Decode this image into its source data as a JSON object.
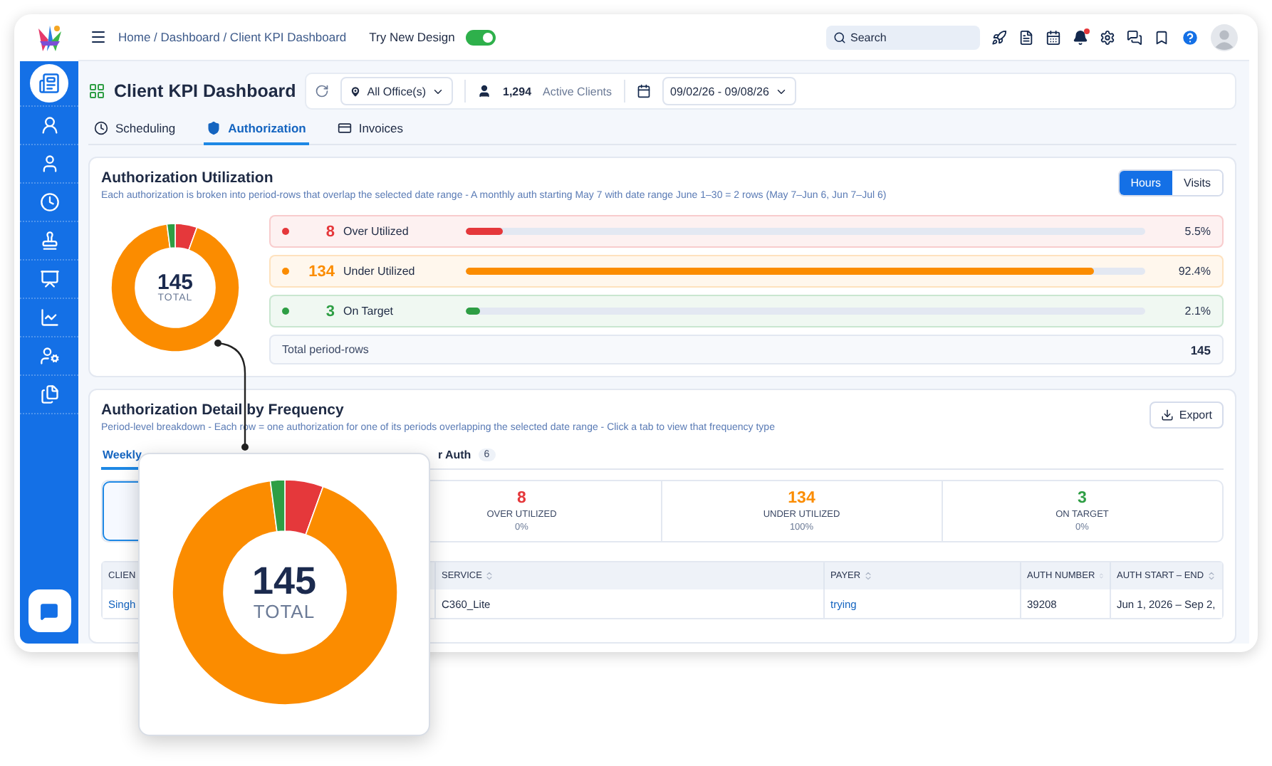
{
  "topbar": {
    "breadcrumb": "Home / Dashboard / Client KPI Dashboard",
    "new_design": {
      "label": "Try New Design",
      "on": true
    },
    "search": {
      "placeholder": "Search"
    },
    "notifications_unread": true
  },
  "sidebar": {
    "items": [
      {
        "selected": true
      },
      {
        "selected": false
      },
      {
        "selected": false
      },
      {
        "selected": false
      },
      {
        "selected": false
      },
      {
        "selected": false
      },
      {
        "selected": false
      },
      {
        "selected": false
      },
      {
        "selected": false
      }
    ]
  },
  "header": {
    "title": "Client KPI Dashboard",
    "office": "All Office(s)",
    "clients_count": "1,294",
    "clients_label": "Active Clients",
    "date_range": "09/02/26 - 09/08/26"
  },
  "tabs": [
    {
      "label": "Scheduling",
      "selected": false
    },
    {
      "label": "Authorization",
      "selected": true
    },
    {
      "label": "Invoices",
      "selected": false
    }
  ],
  "utilization": {
    "title": "Authorization Utilization",
    "subtitle": "Each authorization is broken into period-rows that overlap the selected date range - A monthly auth starting May 7 with date range June 1–30 = 2 rows (May 7–Jun 6, Jun 7–Jul 6)",
    "units": [
      {
        "label": "Hours",
        "selected": true
      },
      {
        "label": "Visits",
        "selected": false
      }
    ],
    "total": "145",
    "total_label": "TOTAL",
    "rows": [
      {
        "count": "8",
        "label": "Over Utilized",
        "level": 0.055,
        "percent": "5.5%",
        "color": "#e5383b"
      },
      {
        "count": "134",
        "label": "Under Utilized",
        "level": 0.924,
        "percent": "92.4%",
        "color": "#fb8c00"
      },
      {
        "count": "3",
        "label": "On Target",
        "level": 0.021,
        "percent": "2.1%",
        "color": "#2e9e44"
      }
    ],
    "total_row": {
      "label": "Total period-rows",
      "value": "145"
    }
  },
  "detail": {
    "title": "Authorization Detail by Frequency",
    "subtitle": "Period-level breakdown - Each row = one authorization for one of its periods overlapping the selected date range - Click a tab to view that frequency type",
    "export": "Export",
    "tabs": [
      {
        "label": "Weekly",
        "selected": true
      },
      {
        "label": "r Auth",
        "count": "6",
        "selected": false
      }
    ],
    "stats": [
      {
        "selected": true
      },
      {
        "value": "8",
        "label": "OVER UTILIZED",
        "percent": "0%",
        "color": "#e5383b",
        "selected": false
      },
      {
        "value": "134",
        "label": "UNDER UTILIZED",
        "percent": "100%",
        "color": "#fb8c00",
        "selected": false
      },
      {
        "value": "3",
        "label": "ON TARGET",
        "percent": "0%",
        "color": "#2e9e44",
        "selected": false
      }
    ],
    "columns": [
      {
        "label": "CLIEN",
        "sortable": false
      },
      {
        "label": "SERVICE",
        "sortable": true
      },
      {
        "label": "PAYER",
        "sortable": true
      },
      {
        "label": "AUTH NUMBER",
        "sortable": true
      },
      {
        "label": "AUTH START – END",
        "sortable": true
      }
    ],
    "rows": [
      [
        {
          "text": "Singh",
          "kind": "link"
        },
        {
          "text": "C360_Lite",
          "kind": "text"
        },
        {
          "text": "trying",
          "kind": "link"
        },
        {
          "text": "39208",
          "kind": "text"
        },
        {
          "text": "Jun 1, 2026 – Sep 2,",
          "kind": "text"
        }
      ]
    ]
  },
  "callout": {
    "total": "145",
    "total_label": "TOTAL"
  }
}
